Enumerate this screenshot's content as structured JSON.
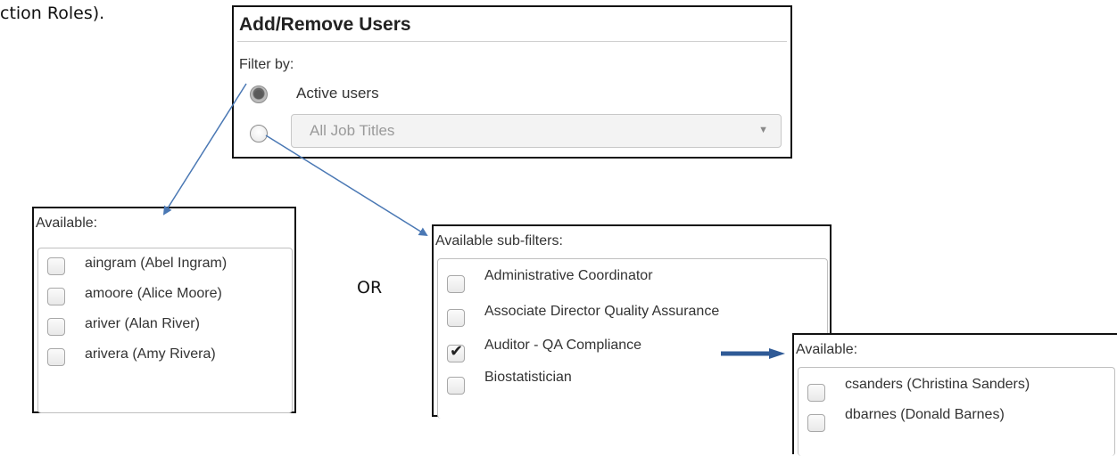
{
  "intro_fragment": "ction Roles).",
  "or_label": "OR",
  "add_remove": {
    "title": "Add/Remove Users",
    "filter_label": "Filter by:",
    "active_label": "Active users",
    "job_select_value": "All Job Titles"
  },
  "available": {
    "header": "Available:",
    "users": [
      "aingram (Abel Ingram)",
      "amoore (Alice Moore)",
      "ariver (Alan River)",
      "arivera (Amy Rivera)"
    ]
  },
  "subfilters": {
    "header": "Available sub-filters:",
    "items": [
      {
        "label": "Administrative Coordinator",
        "checked": false
      },
      {
        "label": "Associate Director Quality Assurance",
        "checked": false
      },
      {
        "label": "Auditor - QA Compliance",
        "checked": true
      },
      {
        "label": "Biostatistician",
        "checked": false
      }
    ]
  },
  "filtered_available": {
    "header": "Available:",
    "users": [
      "csanders (Christina Sanders)",
      "dbarnes (Donald Barnes)"
    ]
  },
  "colors": {
    "arrow": "#4a78b4",
    "border": "#111111"
  }
}
